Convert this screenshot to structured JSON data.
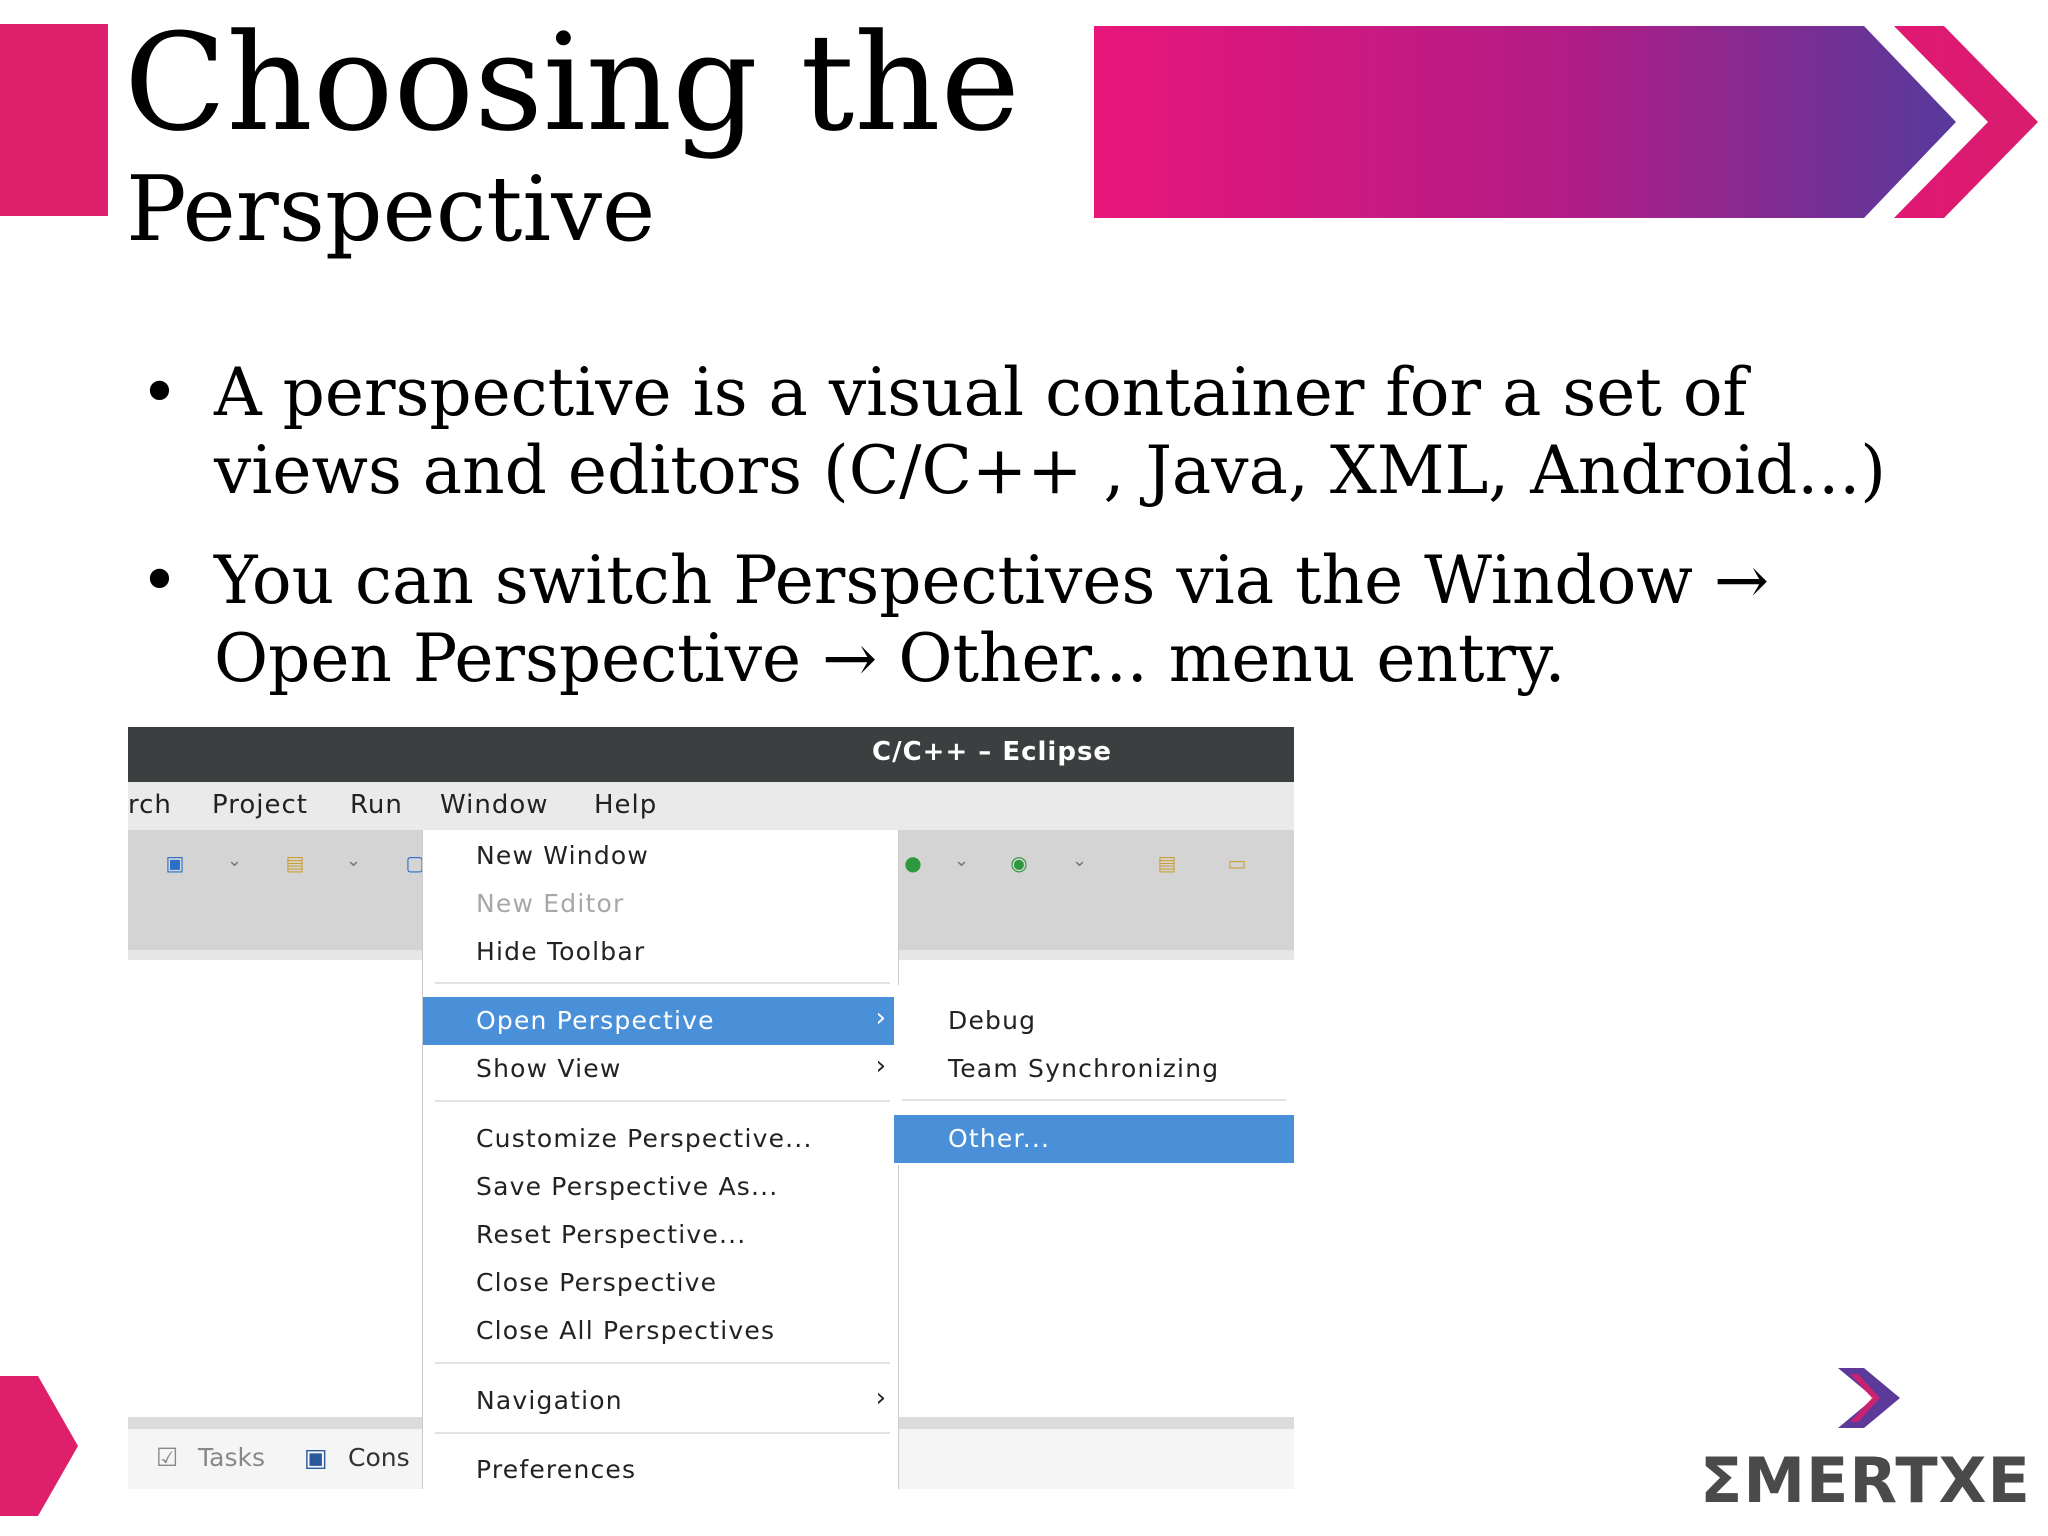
{
  "slide": {
    "title_line1": "Choosing the",
    "title_line2": "Perspective",
    "bullets": [
      {
        "bullet": "•",
        "text": "A perspective is a visual container for a set of views and editors (C/C++ , Java, XML, Android...)"
      },
      {
        "bullet": "•",
        "text": "You can switch Perspectives via the Window → Open Perspective → Other... menu entry."
      }
    ],
    "logo_text": "ΣMERTXE",
    "colors": {
      "accent_pink": "#de1f6b",
      "accent_purple": "#5b3a99",
      "menu_highlight": "#4a90d9"
    }
  },
  "eclipse": {
    "window_title": "C/C++ – Eclipse",
    "menubar": [
      "rch",
      "Project",
      "Run",
      "Window",
      "Help"
    ],
    "toolbar_icons": [
      "new-c-project-icon",
      "open-folder-icon",
      "new-class-icon",
      "run-icon",
      "debug-run-icon",
      "open-workspace-icon",
      "open-file-icon"
    ],
    "window_menu": {
      "items": [
        {
          "label": "New Window",
          "enabled": true
        },
        {
          "label": "New Editor",
          "enabled": false
        },
        {
          "label": "Hide Toolbar",
          "enabled": true
        },
        {
          "label": "Open Perspective",
          "submenu": true,
          "selected": true
        },
        {
          "label": "Show View",
          "submenu": true
        },
        {
          "label": "Customize Perspective..."
        },
        {
          "label": "Save Perspective As..."
        },
        {
          "label": "Reset Perspective..."
        },
        {
          "label": "Close Perspective"
        },
        {
          "label": "Close All Perspectives"
        },
        {
          "label": "Navigation",
          "submenu": true
        },
        {
          "label": "Preferences"
        }
      ],
      "submenu_arrow": "›"
    },
    "open_perspective_submenu": {
      "items": [
        {
          "label": "Debug"
        },
        {
          "label": "Team Synchronizing"
        },
        {
          "label": "Other...",
          "selected": true
        }
      ]
    },
    "bottom_tabs": [
      "Tasks",
      "Cons"
    ]
  }
}
